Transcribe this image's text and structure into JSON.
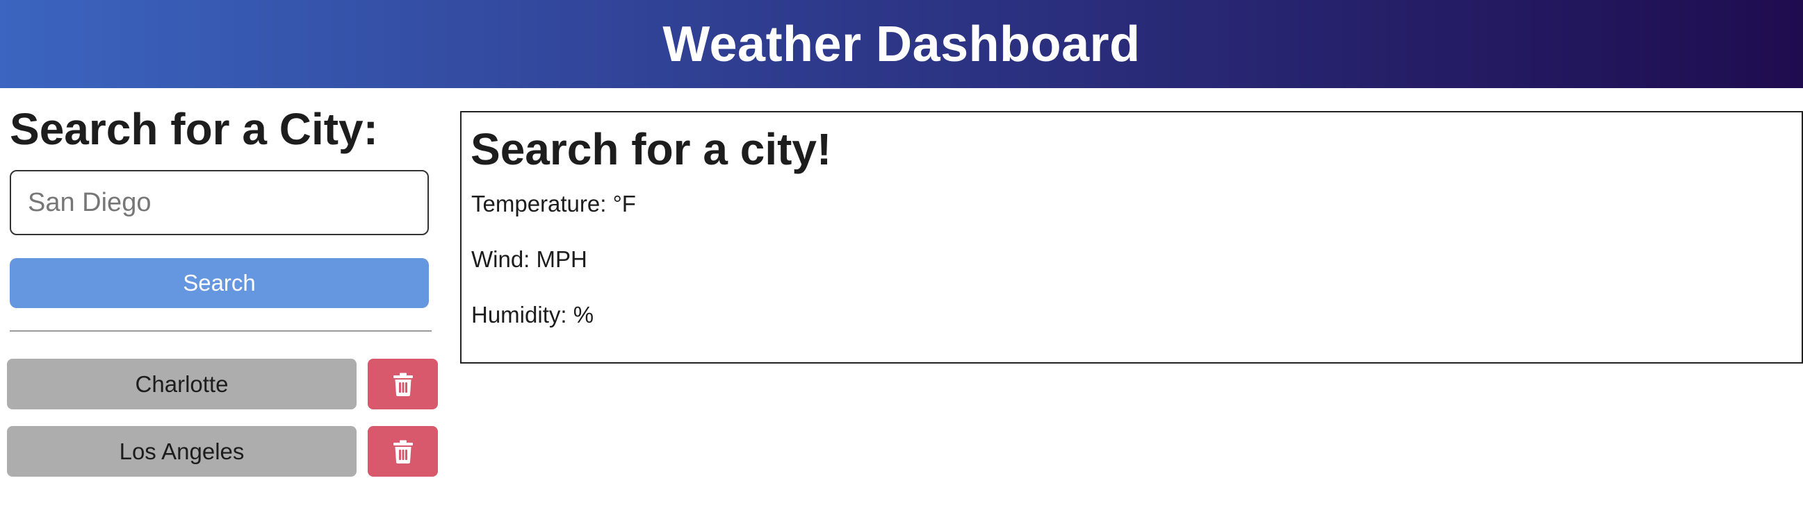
{
  "header": {
    "title": "Weather Dashboard"
  },
  "sidebar": {
    "heading": "Search for a City:",
    "search": {
      "placeholder": "San Diego",
      "value": ""
    },
    "search_button_label": "Search",
    "history": [
      {
        "city": "Charlotte",
        "delete_icon": "trash-icon"
      },
      {
        "city": "Los Angeles",
        "delete_icon": "trash-icon"
      }
    ]
  },
  "weather": {
    "title": "Search for a city!",
    "temperature": "Temperature: °F",
    "wind": "Wind: MPH",
    "humidity": "Humidity: %"
  },
  "colors": {
    "header_gradient_start": "#3b65c0",
    "header_gradient_end": "#1f0c4f",
    "search_button": "#6596e0",
    "history_button": "#adadad",
    "delete_button": "#d9596c"
  }
}
